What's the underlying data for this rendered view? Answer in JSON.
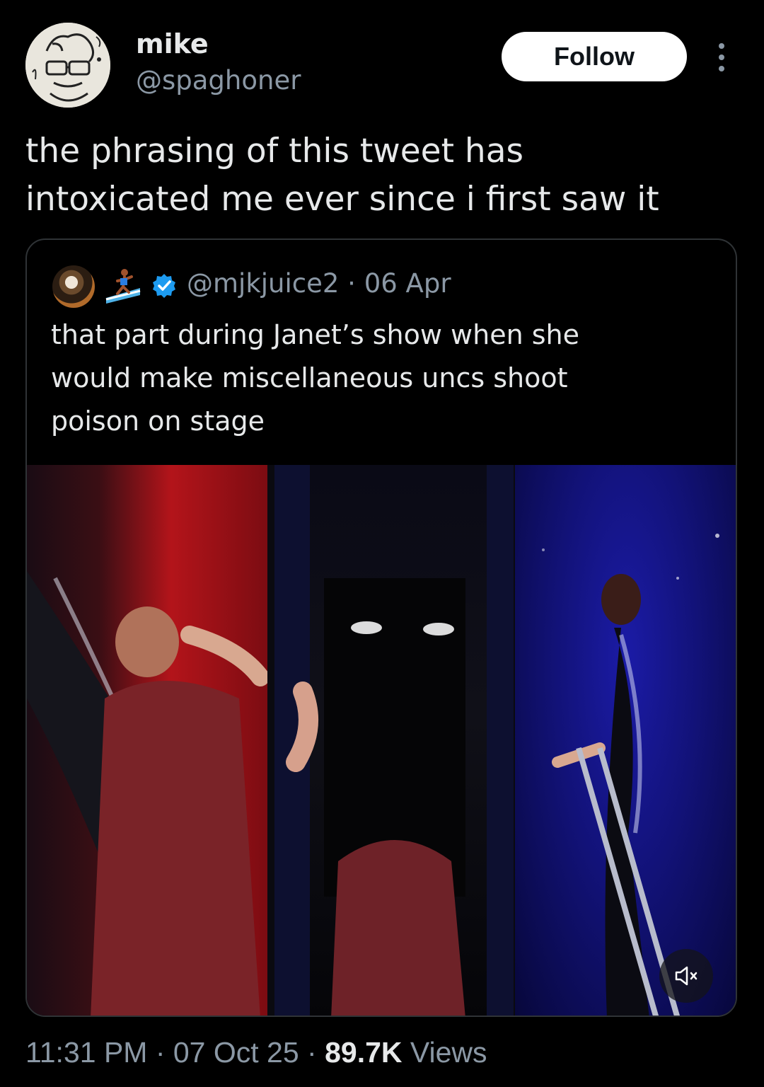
{
  "author": {
    "name": "mike",
    "handle": "@spaghoner",
    "avatar_icon": "sketch-avatar"
  },
  "actions": {
    "follow_label": "Follow",
    "more_icon": "more-vertical-icon"
  },
  "tweet": {
    "text": "the phrasing of this tweet has\nintoxicated me ever since i first saw it"
  },
  "quoted_tweet": {
    "emoji_icon": "surfer-emoji-icon",
    "verified_icon": "verified-badge-icon",
    "handle_line": "@mjkjuice2 · 06 Apr",
    "text": "that part during Janet’s show when she\nwould make miscellaneous uncs shoot\npoison on stage",
    "media": {
      "panels": 3,
      "mute_icon": "volume-muted-icon"
    }
  },
  "footer": {
    "time_date": "11:31 PM · 07 Oct 25 · ",
    "views_count": "89.7K",
    "views_label": " Views"
  },
  "colors": {
    "background": "#000000",
    "text": "#e7e9ea",
    "secondary": "#8b98a5",
    "verified": "#1d9bf0",
    "border": "#2f3336"
  }
}
